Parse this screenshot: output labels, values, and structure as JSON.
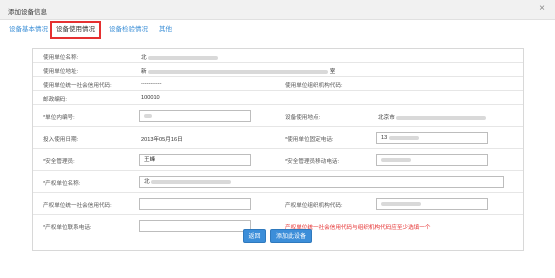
{
  "window": {
    "title": "添加设备信息",
    "close": "×"
  },
  "tabs": [
    {
      "label": "设备基本情况"
    },
    {
      "label": "设备使用情况"
    },
    {
      "label": "设备检验情况"
    },
    {
      "label": "其他"
    }
  ],
  "form": {
    "unit_name_label": "使用单位名称:",
    "unit_name_value": "北",
    "unit_addr_label": "使用单位地址:",
    "unit_addr_value": "新",
    "unit_addr_suffix": "室",
    "credit_code_label": "使用单位统一社会信用代码:",
    "credit_code_value": "-----------",
    "org_code_label": "使用单位组织机构代码:",
    "postcode_label": "邮政编码:",
    "postcode_value": "100010",
    "internal_no_label": "*单位内编号:",
    "location_label": "设备使用地点:",
    "location_value": "北京市",
    "start_date_label": "投入使用日期:",
    "start_date_value": "2013年05月16日",
    "fixed_phone_label": "*使用单位固定电话:",
    "fixed_phone_value": "13",
    "safety_mgr_label": "*安全管理员:",
    "safety_mgr_value": "王峰",
    "safety_mobile_label": "*安全管理员移动电话:",
    "owner_name_label": "*产权单位名称:",
    "owner_name_value": "北",
    "owner_credit_label": "产权单位统一社会信用代码:",
    "owner_org_label": "产权单位组织机构代码:",
    "owner_phone_label": "*产权单位联系电话:",
    "owner_note": "产权单位统一社会信用代码与组织机构代码应至少选填一个"
  },
  "buttons": {
    "back": "返回",
    "add": "添加此设备"
  }
}
